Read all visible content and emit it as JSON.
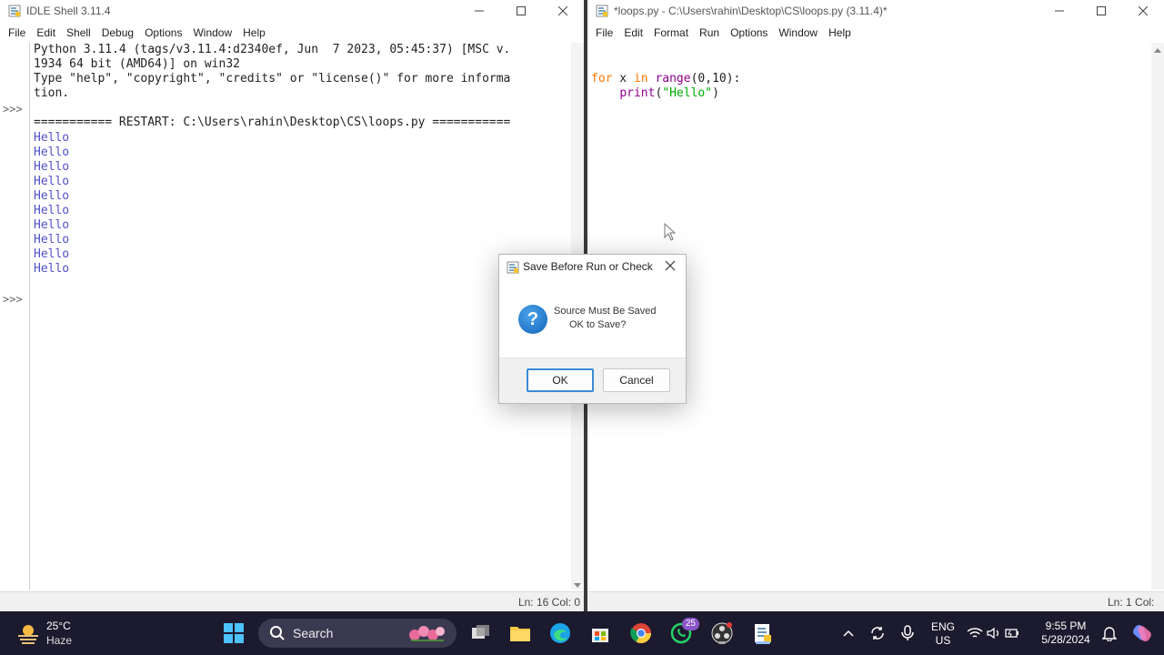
{
  "shell": {
    "title": "IDLE Shell 3.11.4",
    "menu": [
      "File",
      "Edit",
      "Shell",
      "Debug",
      "Options",
      "Window",
      "Help"
    ],
    "banner_line1": "Python 3.11.4 (tags/v3.11.4:d2340ef, Jun  7 2023, 05:45:37) [MSC v.",
    "banner_line2": "1934 64 bit (AMD64)] on win32",
    "banner_line3": "Type \"help\", \"copyright\", \"credits\" or \"license()\" for more informa",
    "banner_line4": "tion.",
    "restart_line": "=========== RESTART: C:\\Users\\rahin\\Desktop\\CS\\loops.py ===========",
    "output": [
      "Hello",
      "Hello",
      "Hello",
      "Hello",
      "Hello",
      "Hello",
      "Hello",
      "Hello",
      "Hello",
      "Hello"
    ],
    "prompt": ">>>",
    "status": "Ln: 16   Col: 0"
  },
  "editor": {
    "title": "*loops.py - C:\\Users\\rahin\\Desktop\\CS\\loops.py (3.11.4)*",
    "menu": [
      "File",
      "Edit",
      "Format",
      "Run",
      "Options",
      "Window",
      "Help"
    ],
    "code": {
      "kw_for": "for",
      "var": " x ",
      "kw_in": "in",
      "space": " ",
      "fn_range": "range",
      "range_args": "(0,10):",
      "indent": "    ",
      "fn_print": "print",
      "paren_open": "(",
      "str_hello": "\"Hello\"",
      "paren_close": ")"
    },
    "status": "Ln: 1   Col:"
  },
  "dialog": {
    "title": "Save Before Run or Check",
    "message_line1": "Source Must Be Saved",
    "message_line2": "OK to Save?",
    "ok_label": "OK",
    "cancel_label": "Cancel",
    "icon_glyph": "?"
  },
  "taskbar": {
    "weather_temp": "25°C",
    "weather_desc": "Haze",
    "search_label": "Search",
    "whatsapp_badge": "25",
    "lang_line1": "ENG",
    "lang_line2": "US",
    "time": "9:55 PM",
    "date": "5/28/2024"
  },
  "colors": {
    "keyword": "#ff7700",
    "builtin": "#900090",
    "string": "#00aa00",
    "shell_output": "#5050cc",
    "taskbar_bg": "#1c1a2e",
    "dialog_ok_border": "#3a8bd8"
  },
  "icons": {
    "python_app": "python-feather-icon",
    "minimize": "minimize-icon",
    "maximize": "maximize-icon",
    "close": "close-icon",
    "question": "question-icon",
    "windows_start": "windows-start-icon",
    "search": "search-icon"
  }
}
